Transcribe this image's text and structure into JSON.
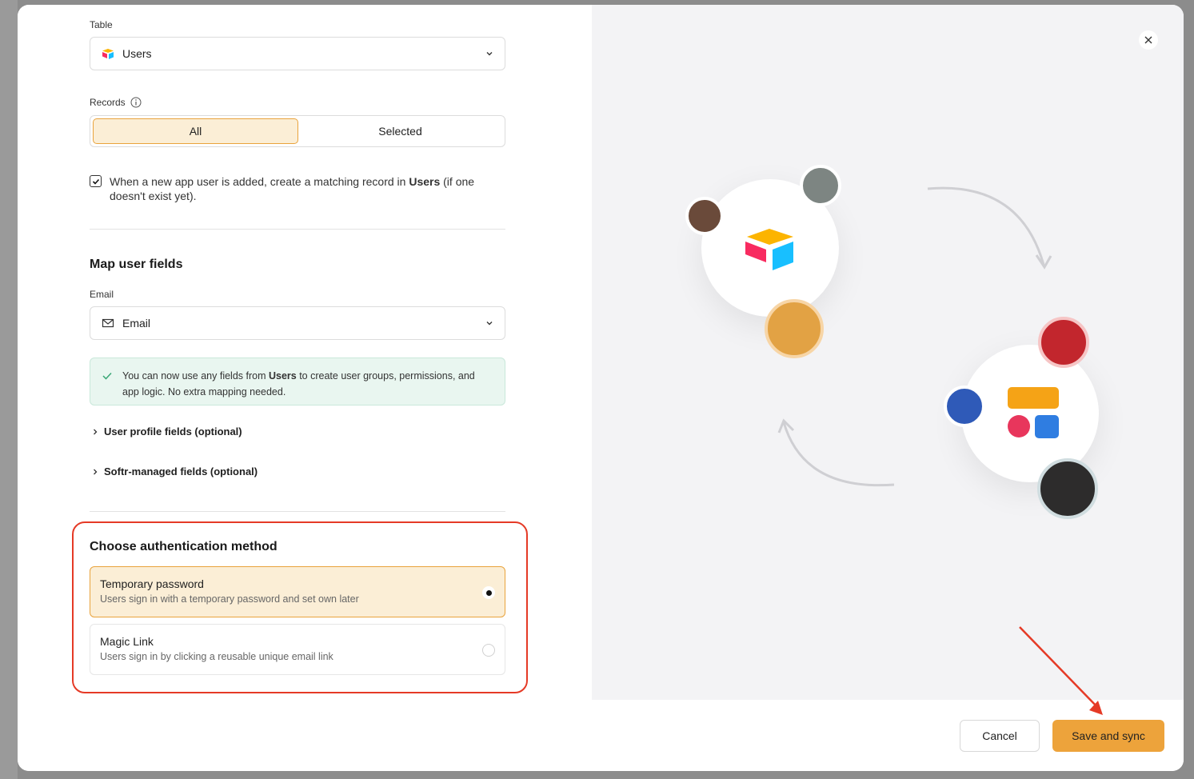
{
  "form": {
    "table_label": "Table",
    "table_value": "Users",
    "records_label": "Records",
    "records_options": [
      "All",
      "Selected"
    ],
    "records_selected": "All",
    "auto_create_text_pre": "When a new app user is added, create a matching record in ",
    "auto_create_text_bold": "Users",
    "auto_create_text_post": " (if one doesn't exist yet).",
    "auto_create_checked": true,
    "map_heading": "Map user fields",
    "email_label": "Email",
    "email_value": "Email",
    "notice_pre": "You can now use any fields from ",
    "notice_bold": "Users",
    "notice_post": " to create user groups, permissions, and app logic. No extra mapping needed.",
    "accordion_profile": "User profile fields (optional)",
    "accordion_softr": "Softr-managed fields (optional)",
    "auth_heading": "Choose authentication method",
    "auth_options": [
      {
        "title": "Temporary password",
        "desc": "Users sign in with a temporary password and set own later",
        "selected": true
      },
      {
        "title": "Magic Link",
        "desc": "Users sign in by clicking a reusable unique email link",
        "selected": false
      }
    ]
  },
  "footer": {
    "cancel_label": "Cancel",
    "save_label": "Save and sync"
  },
  "colors": {
    "accent": "#eda33b",
    "selected_bg": "#fbeed6",
    "highlight": "#e53a26",
    "success_bg": "#e9f6f0"
  },
  "icons": [
    "airtable-icon",
    "chevron-down-icon",
    "info-icon",
    "check-icon",
    "mail-icon",
    "chevron-right-icon",
    "close-icon",
    "softr-icon"
  ]
}
